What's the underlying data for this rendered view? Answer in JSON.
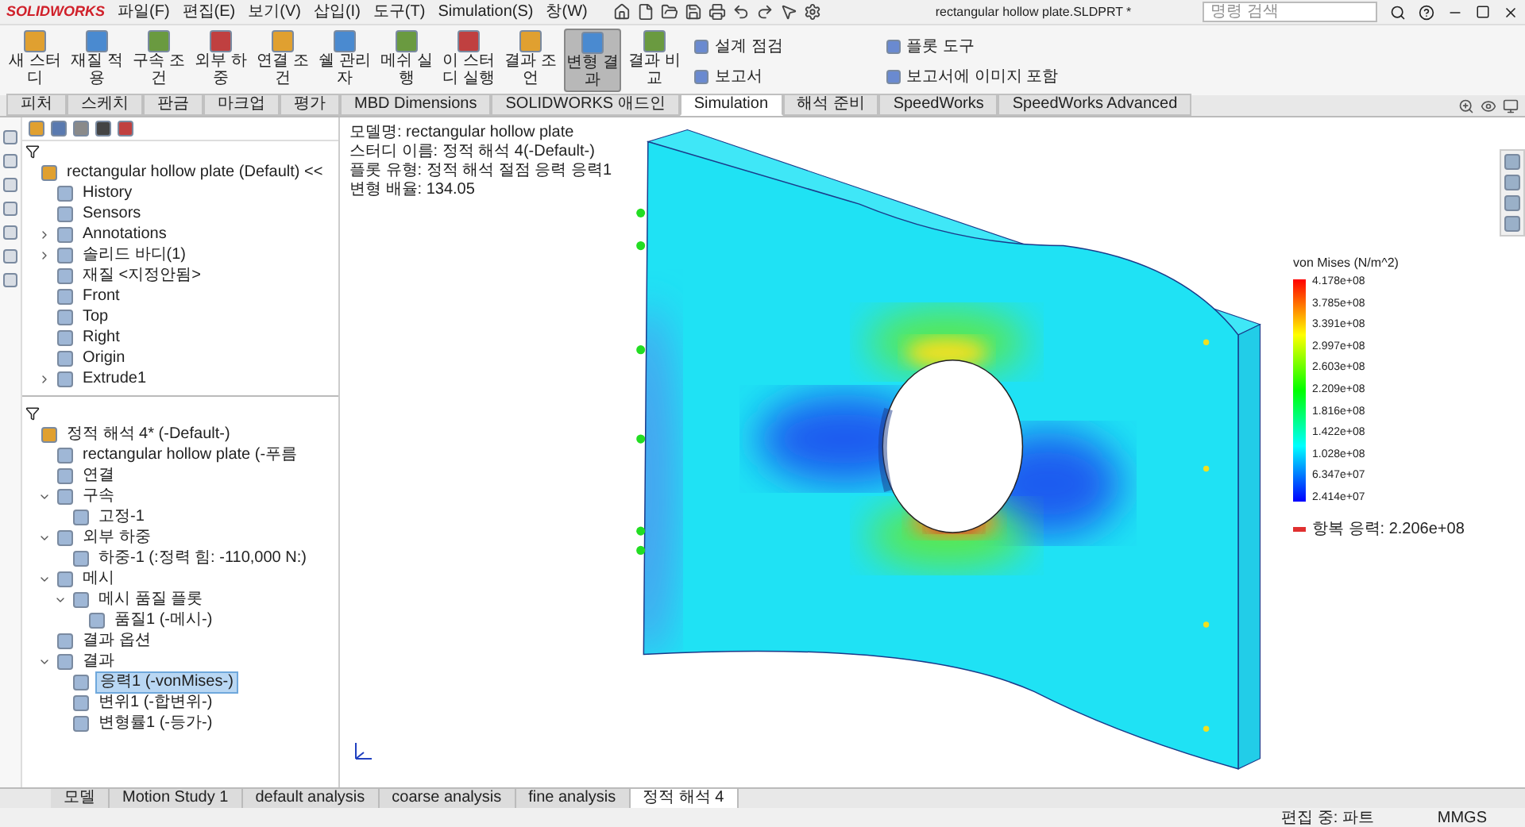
{
  "app": {
    "logo": "SOLIDWORKS",
    "menus": [
      "파일(F)",
      "편집(E)",
      "보기(V)",
      "삽입(I)",
      "도구(T)",
      "Simulation(S)",
      "창(W)"
    ],
    "title": "rectangular hollow plate.SLDPRT *",
    "search": {
      "placeholder": "명령 검색"
    }
  },
  "ribbon": {
    "buttons": [
      {
        "label": "새 스터디",
        "selected": false
      },
      {
        "label": "재질 적용",
        "selected": false
      },
      {
        "label": "구속 조건",
        "selected": false
      },
      {
        "label": "외부 하중",
        "selected": false
      },
      {
        "label": "연결 조건",
        "selected": false
      },
      {
        "label": "쉘 관리자",
        "selected": false
      },
      {
        "label": "메쉬 실행",
        "selected": false
      },
      {
        "label": "이 스터디 실행",
        "selected": false
      },
      {
        "label": "결과 조언",
        "selected": false
      },
      {
        "label": "변형 결과",
        "selected": true
      },
      {
        "label": "결과 비교",
        "selected": false
      }
    ],
    "small_buttons": [
      "설계 점검",
      "플롯 도구",
      "보고서",
      "보고서에 이미지 포함"
    ]
  },
  "tabs": [
    {
      "label": "피처",
      "selected": false
    },
    {
      "label": "스케치",
      "selected": false
    },
    {
      "label": "판금",
      "selected": false
    },
    {
      "label": "마크업",
      "selected": false
    },
    {
      "label": "평가",
      "selected": false
    },
    {
      "label": "MBD Dimensions",
      "selected": false
    },
    {
      "label": "SOLIDWORKS 애드인",
      "selected": false
    },
    {
      "label": "Simulation",
      "selected": true
    },
    {
      "label": "해석 준비",
      "selected": false
    },
    {
      "label": "SpeedWorks",
      "selected": false
    },
    {
      "label": "SpeedWorks Advanced",
      "selected": false
    }
  ],
  "feature_tree": {
    "label": "rectangular hollow plate (Default) <<",
    "children": [
      {
        "label": "History"
      },
      {
        "label": "Sensors"
      },
      {
        "label": "Annotations",
        "expanded": false
      },
      {
        "label": "솔리드 바디(1)",
        "expanded": false
      },
      {
        "label": "재질 <지정안됨>"
      },
      {
        "label": "Front"
      },
      {
        "label": "Top"
      },
      {
        "label": "Right"
      },
      {
        "label": "Origin"
      },
      {
        "label": "Extrude1",
        "expanded": false
      }
    ]
  },
  "study_tree": {
    "label": "정적 해석 4* (-Default-)",
    "selected": false,
    "children": [
      {
        "label": "rectangular hollow plate (-푸름",
        "selected": false
      },
      {
        "label": "연결",
        "selected": false
      },
      {
        "label": "구속",
        "expanded": true,
        "selected": false,
        "children": [
          {
            "label": "고정-1",
            "selected": false
          }
        ]
      },
      {
        "label": "외부 하중",
        "expanded": true,
        "selected": false,
        "children": [
          {
            "label": "하중-1 (:정력 힘: -110,000 N:)",
            "selected": false
          }
        ]
      },
      {
        "label": "메시",
        "expanded": true,
        "selected": false,
        "children": [
          {
            "label": "메시 품질 플롯",
            "expanded": true,
            "selected": false,
            "children": [
              {
                "label": "품질1 (-메시-)",
                "selected": false
              }
            ]
          }
        ]
      },
      {
        "label": "결과 옵션",
        "selected": false
      },
      {
        "label": "결과",
        "expanded": true,
        "selected": false,
        "children": [
          {
            "label": "응력1 (-vonMises-)",
            "selected": true
          },
          {
            "label": "변위1 (-합변위-)",
            "selected": false
          },
          {
            "label": "변형률1 (-등가-)",
            "selected": false
          }
        ]
      }
    ]
  },
  "viewport": {
    "info": [
      "모델명: rectangular hollow plate",
      "스터디 이름: 정적 해석 4(-Default-)",
      "플롯 유형: 정적 해석 절점 응력 응력1",
      "변형 배율: 134.05"
    ],
    "legend": {
      "title": "von Mises (N/m^2)",
      "ticks": [
        "4.178e+08",
        "3.785e+08",
        "3.391e+08",
        "2.997e+08",
        "2.603e+08",
        "2.209e+08",
        "1.816e+08",
        "1.422e+08",
        "1.028e+08",
        "6.347e+07",
        "2.414e+07"
      ],
      "yield_label": "항복 응력: 2.206e+08"
    }
  },
  "bottom_tabs": [
    {
      "label": "모델",
      "selected": false
    },
    {
      "label": "Motion Study 1",
      "selected": false
    },
    {
      "label": "default analysis",
      "selected": false
    },
    {
      "label": "coarse analysis",
      "selected": false
    },
    {
      "label": "fine analysis",
      "selected": false
    },
    {
      "label": "정적 해석 4",
      "selected": true
    }
  ],
  "status": [
    "편집 중: 파트",
    "MMGS"
  ]
}
